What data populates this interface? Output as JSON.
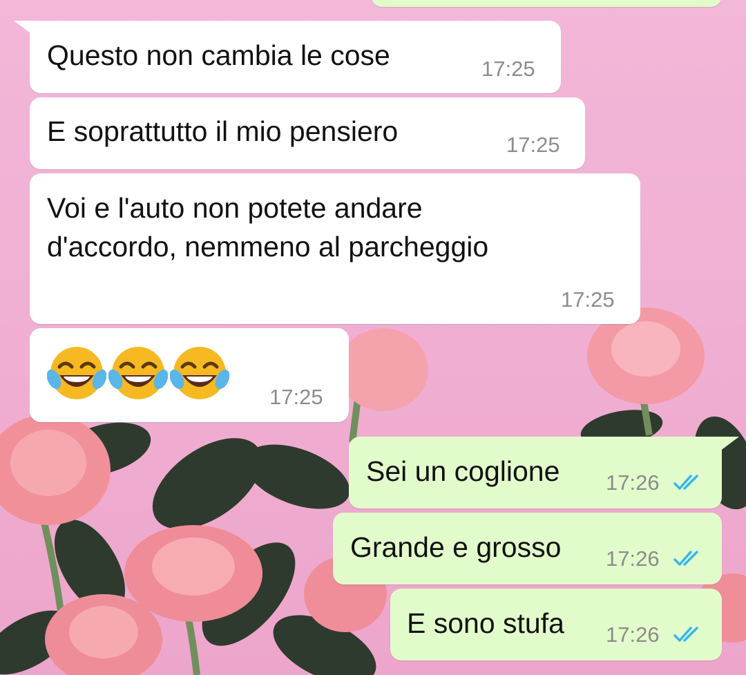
{
  "chat": {
    "incoming": [
      {
        "text": "Questo non cambia le cose",
        "time": "17:25"
      },
      {
        "text": "E soprattutto il mio pensiero",
        "time": "17:25"
      },
      {
        "line1": "Voi e l'auto non potete andare",
        "line2": "d'accordo, nemmeno al parcheggio",
        "time": "17:25"
      },
      {
        "emoji_icons": [
          "face-with-tears-of-joy-icon",
          "face-with-tears-of-joy-icon",
          "face-with-tears-of-joy-icon"
        ],
        "time": "17:25"
      }
    ],
    "outgoing": [
      {
        "text": "Sei un coglione",
        "time": "17:26",
        "status": "read"
      },
      {
        "text": "Grande e grosso",
        "time": "17:26",
        "status": "read"
      },
      {
        "text": "E sono stufa",
        "time": "17:26",
        "status": "read"
      }
    ]
  },
  "colors": {
    "incoming_bubble": "#ffffff",
    "outgoing_bubble": "#e2fbcb",
    "read_ticks": "#34b7f1",
    "wallpaper": "#f0b0d3"
  }
}
